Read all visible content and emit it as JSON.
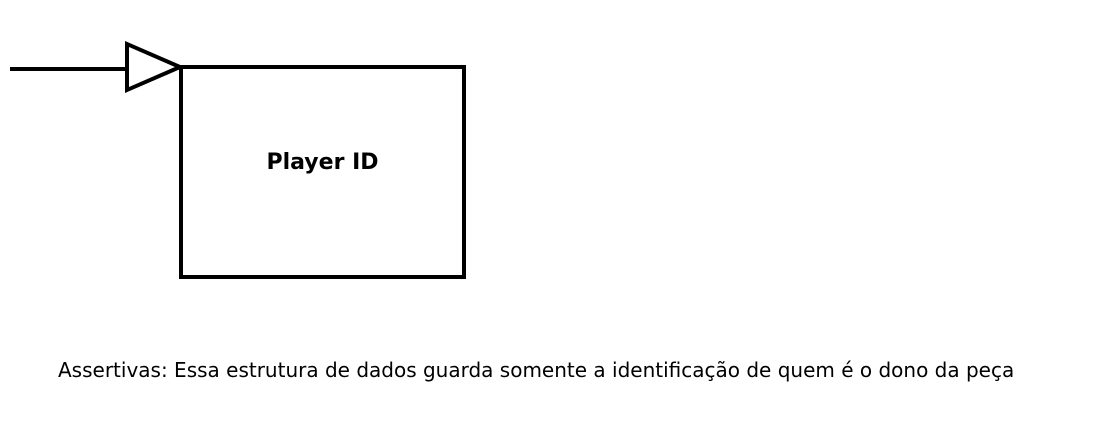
{
  "diagram": {
    "node": {
      "label": "Player ID"
    },
    "caption": "Assertivas: Essa estrutura de dados guarda somente a identificação de quem é o dono da peça",
    "colors": {
      "stroke": "#000000",
      "background": "#ffffff"
    }
  }
}
